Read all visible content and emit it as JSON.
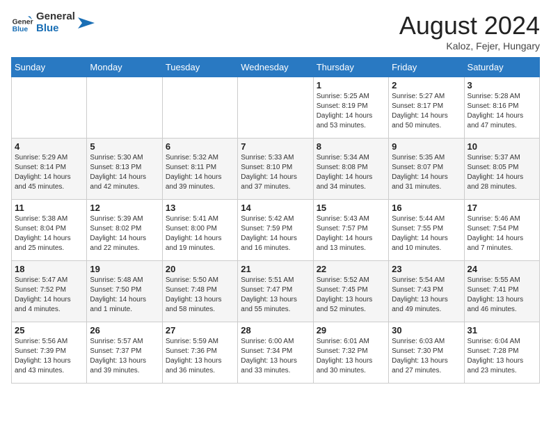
{
  "header": {
    "logo_general": "General",
    "logo_blue": "Blue",
    "month_year": "August 2024",
    "location": "Kaloz, Fejer, Hungary"
  },
  "weekdays": [
    "Sunday",
    "Monday",
    "Tuesday",
    "Wednesday",
    "Thursday",
    "Friday",
    "Saturday"
  ],
  "weeks": [
    [
      null,
      null,
      null,
      null,
      {
        "day": 1,
        "sunrise": "5:25 AM",
        "sunset": "8:19 PM",
        "daylight": "14 hours and 53 minutes."
      },
      {
        "day": 2,
        "sunrise": "5:27 AM",
        "sunset": "8:17 PM",
        "daylight": "14 hours and 50 minutes."
      },
      {
        "day": 3,
        "sunrise": "5:28 AM",
        "sunset": "8:16 PM",
        "daylight": "14 hours and 47 minutes."
      }
    ],
    [
      {
        "day": 4,
        "sunrise": "5:29 AM",
        "sunset": "8:14 PM",
        "daylight": "14 hours and 45 minutes."
      },
      {
        "day": 5,
        "sunrise": "5:30 AM",
        "sunset": "8:13 PM",
        "daylight": "14 hours and 42 minutes."
      },
      {
        "day": 6,
        "sunrise": "5:32 AM",
        "sunset": "8:11 PM",
        "daylight": "14 hours and 39 minutes."
      },
      {
        "day": 7,
        "sunrise": "5:33 AM",
        "sunset": "8:10 PM",
        "daylight": "14 hours and 37 minutes."
      },
      {
        "day": 8,
        "sunrise": "5:34 AM",
        "sunset": "8:08 PM",
        "daylight": "14 hours and 34 minutes."
      },
      {
        "day": 9,
        "sunrise": "5:35 AM",
        "sunset": "8:07 PM",
        "daylight": "14 hours and 31 minutes."
      },
      {
        "day": 10,
        "sunrise": "5:37 AM",
        "sunset": "8:05 PM",
        "daylight": "14 hours and 28 minutes."
      }
    ],
    [
      {
        "day": 11,
        "sunrise": "5:38 AM",
        "sunset": "8:04 PM",
        "daylight": "14 hours and 25 minutes."
      },
      {
        "day": 12,
        "sunrise": "5:39 AM",
        "sunset": "8:02 PM",
        "daylight": "14 hours and 22 minutes."
      },
      {
        "day": 13,
        "sunrise": "5:41 AM",
        "sunset": "8:00 PM",
        "daylight": "14 hours and 19 minutes."
      },
      {
        "day": 14,
        "sunrise": "5:42 AM",
        "sunset": "7:59 PM",
        "daylight": "14 hours and 16 minutes."
      },
      {
        "day": 15,
        "sunrise": "5:43 AM",
        "sunset": "7:57 PM",
        "daylight": "14 hours and 13 minutes."
      },
      {
        "day": 16,
        "sunrise": "5:44 AM",
        "sunset": "7:55 PM",
        "daylight": "14 hours and 10 minutes."
      },
      {
        "day": 17,
        "sunrise": "5:46 AM",
        "sunset": "7:54 PM",
        "daylight": "14 hours and 7 minutes."
      }
    ],
    [
      {
        "day": 18,
        "sunrise": "5:47 AM",
        "sunset": "7:52 PM",
        "daylight": "14 hours and 4 minutes."
      },
      {
        "day": 19,
        "sunrise": "5:48 AM",
        "sunset": "7:50 PM",
        "daylight": "14 hours and 1 minute."
      },
      {
        "day": 20,
        "sunrise": "5:50 AM",
        "sunset": "7:48 PM",
        "daylight": "13 hours and 58 minutes."
      },
      {
        "day": 21,
        "sunrise": "5:51 AM",
        "sunset": "7:47 PM",
        "daylight": "13 hours and 55 minutes."
      },
      {
        "day": 22,
        "sunrise": "5:52 AM",
        "sunset": "7:45 PM",
        "daylight": "13 hours and 52 minutes."
      },
      {
        "day": 23,
        "sunrise": "5:54 AM",
        "sunset": "7:43 PM",
        "daylight": "13 hours and 49 minutes."
      },
      {
        "day": 24,
        "sunrise": "5:55 AM",
        "sunset": "7:41 PM",
        "daylight": "13 hours and 46 minutes."
      }
    ],
    [
      {
        "day": 25,
        "sunrise": "5:56 AM",
        "sunset": "7:39 PM",
        "daylight": "13 hours and 43 minutes."
      },
      {
        "day": 26,
        "sunrise": "5:57 AM",
        "sunset": "7:37 PM",
        "daylight": "13 hours and 39 minutes."
      },
      {
        "day": 27,
        "sunrise": "5:59 AM",
        "sunset": "7:36 PM",
        "daylight": "13 hours and 36 minutes."
      },
      {
        "day": 28,
        "sunrise": "6:00 AM",
        "sunset": "7:34 PM",
        "daylight": "13 hours and 33 minutes."
      },
      {
        "day": 29,
        "sunrise": "6:01 AM",
        "sunset": "7:32 PM",
        "daylight": "13 hours and 30 minutes."
      },
      {
        "day": 30,
        "sunrise": "6:03 AM",
        "sunset": "7:30 PM",
        "daylight": "13 hours and 27 minutes."
      },
      {
        "day": 31,
        "sunrise": "6:04 AM",
        "sunset": "7:28 PM",
        "daylight": "13 hours and 23 minutes."
      }
    ]
  ],
  "labels": {
    "sunrise": "Sunrise:",
    "sunset": "Sunset:",
    "daylight": "Daylight:"
  }
}
